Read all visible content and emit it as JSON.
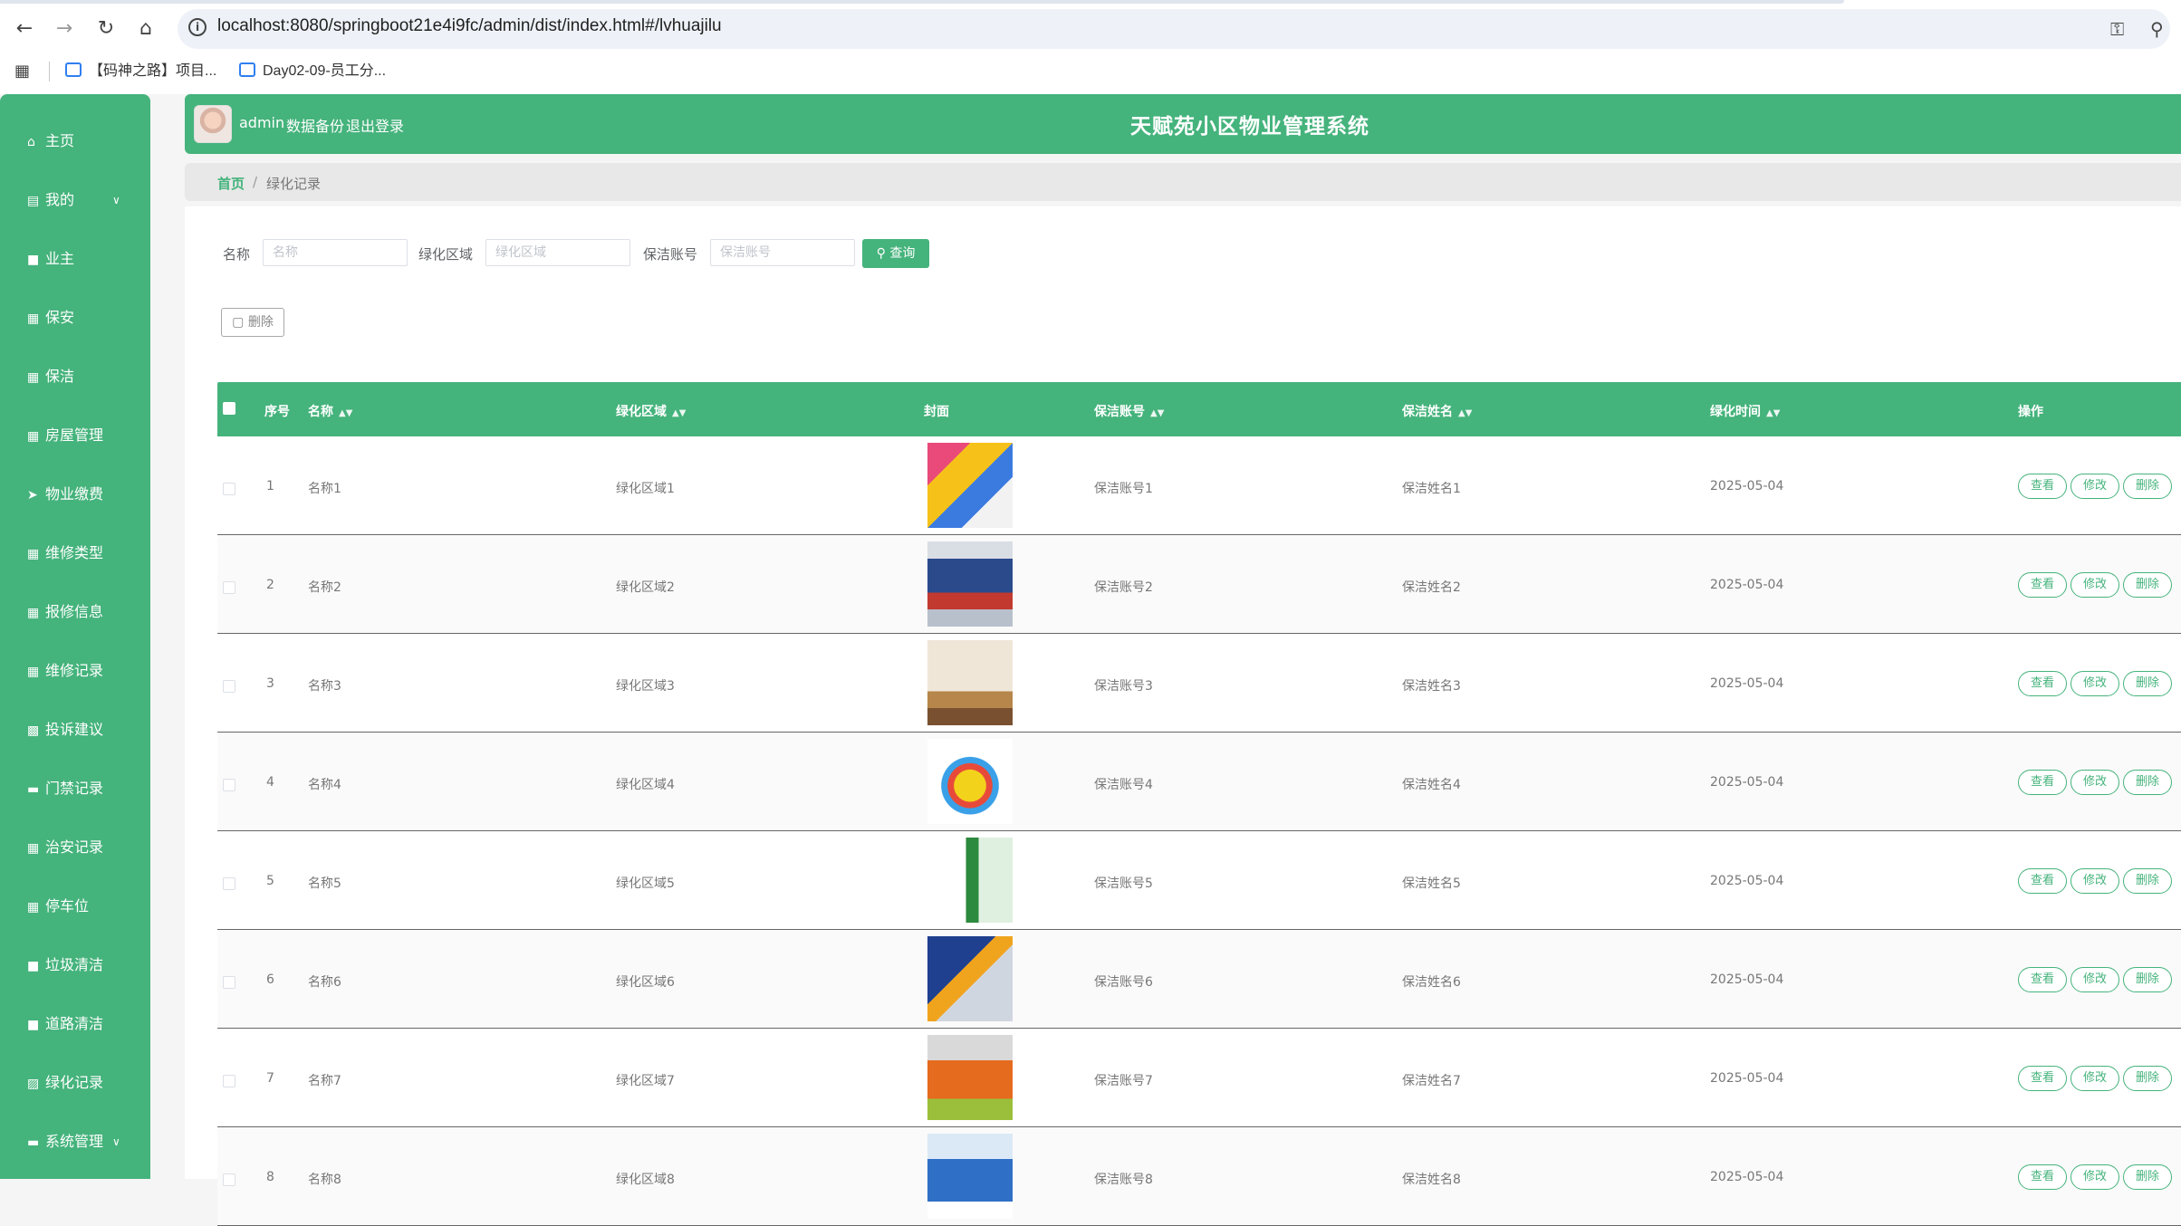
{
  "browser": {
    "url": "localhost:8080/springboot21e4i9fc/admin/dist/index.html#/lvhuajilu",
    "bookmarks": [
      "【码神之路】项目...",
      "Day02-09-员工分..."
    ]
  },
  "sidebar": {
    "items": [
      {
        "icon": "home-icon",
        "label": "主页"
      },
      {
        "icon": "calendar-icon",
        "label": "我的",
        "caret": true
      },
      {
        "icon": "user-icon",
        "label": "业主"
      },
      {
        "icon": "grid-icon",
        "label": "保安"
      },
      {
        "icon": "grid-icon",
        "label": "保洁"
      },
      {
        "icon": "grid-icon",
        "label": "房屋管理"
      },
      {
        "icon": "send-icon",
        "label": "物业缴费"
      },
      {
        "icon": "grid-icon",
        "label": "维修类型"
      },
      {
        "icon": "grid-icon",
        "label": "报修信息"
      },
      {
        "icon": "grid-icon",
        "label": "维修记录"
      },
      {
        "icon": "bar-chart-icon",
        "label": "投诉建议"
      },
      {
        "icon": "message-icon",
        "label": "门禁记录"
      },
      {
        "icon": "table-icon",
        "label": "治安记录"
      },
      {
        "icon": "grid-icon",
        "label": "停车位"
      },
      {
        "icon": "trash-icon",
        "label": "垃圾清洁"
      },
      {
        "icon": "trash-icon",
        "label": "道路清洁"
      },
      {
        "icon": "document-icon",
        "label": "绿化记录"
      },
      {
        "icon": "keyboard-icon",
        "label": "系统管理",
        "caret": true
      }
    ]
  },
  "header": {
    "username": "admin",
    "backup_label": "数据备份",
    "logout_label": "退出登录",
    "system_title": "天赋苑小区物业管理系统"
  },
  "breadcrumb": {
    "home": "首页",
    "separator": "/",
    "current": "绿化记录"
  },
  "search": {
    "name_label": "名称",
    "name_placeholder": "名称",
    "area_label": "绿化区域",
    "area_placeholder": "绿化区域",
    "account_label": "保洁账号",
    "account_placeholder": "保洁账号",
    "query_label": "查询",
    "delete_label": "删除"
  },
  "table": {
    "headers": [
      "序号",
      "名称",
      "绿化区域",
      "封面",
      "保洁账号",
      "保洁姓名",
      "绿化时间",
      "操作"
    ],
    "action_labels": [
      "查看",
      "修改",
      "删除"
    ],
    "rows": [
      {
        "index": "1",
        "name": "名称1",
        "area": "绿化区域1",
        "account": "保洁账号1",
        "cleaner": "保洁姓名1",
        "date": "2025-05-04"
      },
      {
        "index": "2",
        "name": "名称2",
        "area": "绿化区域2",
        "account": "保洁账号2",
        "cleaner": "保洁姓名2",
        "date": "2025-05-04"
      },
      {
        "index": "3",
        "name": "名称3",
        "area": "绿化区域3",
        "account": "保洁账号3",
        "cleaner": "保洁姓名3",
        "date": "2025-05-04"
      },
      {
        "index": "4",
        "name": "名称4",
        "area": "绿化区域4",
        "account": "保洁账号4",
        "cleaner": "保洁姓名4",
        "date": "2025-05-04"
      },
      {
        "index": "5",
        "name": "名称5",
        "area": "绿化区域5",
        "account": "保洁账号5",
        "cleaner": "保洁姓名5",
        "date": "2025-05-04"
      },
      {
        "index": "6",
        "name": "名称6",
        "area": "绿化区域6",
        "account": "保洁账号6",
        "cleaner": "保洁姓名6",
        "date": "2025-05-04"
      },
      {
        "index": "7",
        "name": "名称7",
        "area": "绿化区域7",
        "account": "保洁账号7",
        "cleaner": "保洁姓名7",
        "date": "2025-05-04"
      },
      {
        "index": "8",
        "name": "名称8",
        "area": "绿化区域8",
        "account": "保洁账号8",
        "cleaner": "保洁姓名8",
        "date": "2025-05-04"
      }
    ]
  },
  "colors": {
    "accent": "#45b37c",
    "header_text": "#ffffff",
    "body_text": "#777777"
  }
}
